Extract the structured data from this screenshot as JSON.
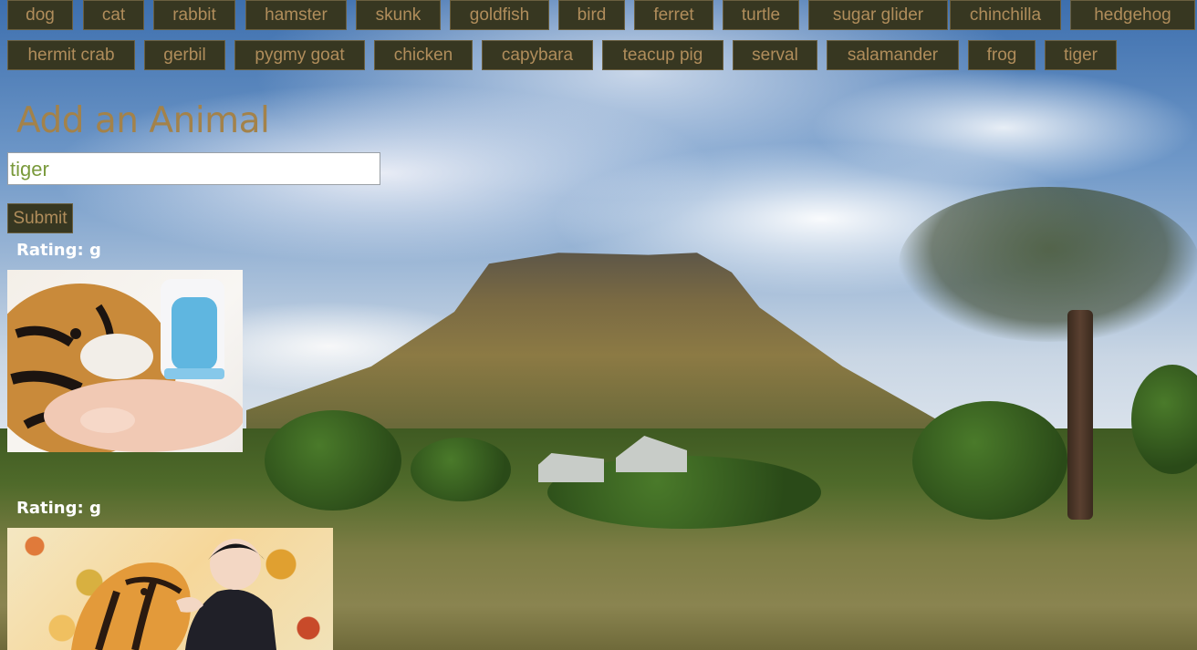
{
  "nav": {
    "buttons": [
      "dog",
      "cat",
      "rabbit",
      "hamster",
      "skunk",
      "goldfish",
      "bird",
      "ferret",
      "turtle",
      "sugar glider",
      "chinchilla",
      "hedgehog",
      "hermit crab",
      "gerbil",
      "pygmy goat",
      "chicken",
      "capybara",
      "teacup pig",
      "serval",
      "salamander",
      "frog",
      "tiger"
    ]
  },
  "form": {
    "title": "Add an Animal",
    "input_value": "tiger",
    "submit_label": "Submit"
  },
  "results": [
    {
      "rating": "Rating: g",
      "image_icon": "tiger-cub-bottle-image"
    },
    {
      "rating": "Rating: g",
      "image_icon": "tiger-anime-image"
    }
  ],
  "colors": {
    "button_bg": "#373721",
    "button_text": "#b08d5b",
    "title": "#a3824a",
    "input_text": "#7a9a3c",
    "rating_text": "#ffffff"
  }
}
